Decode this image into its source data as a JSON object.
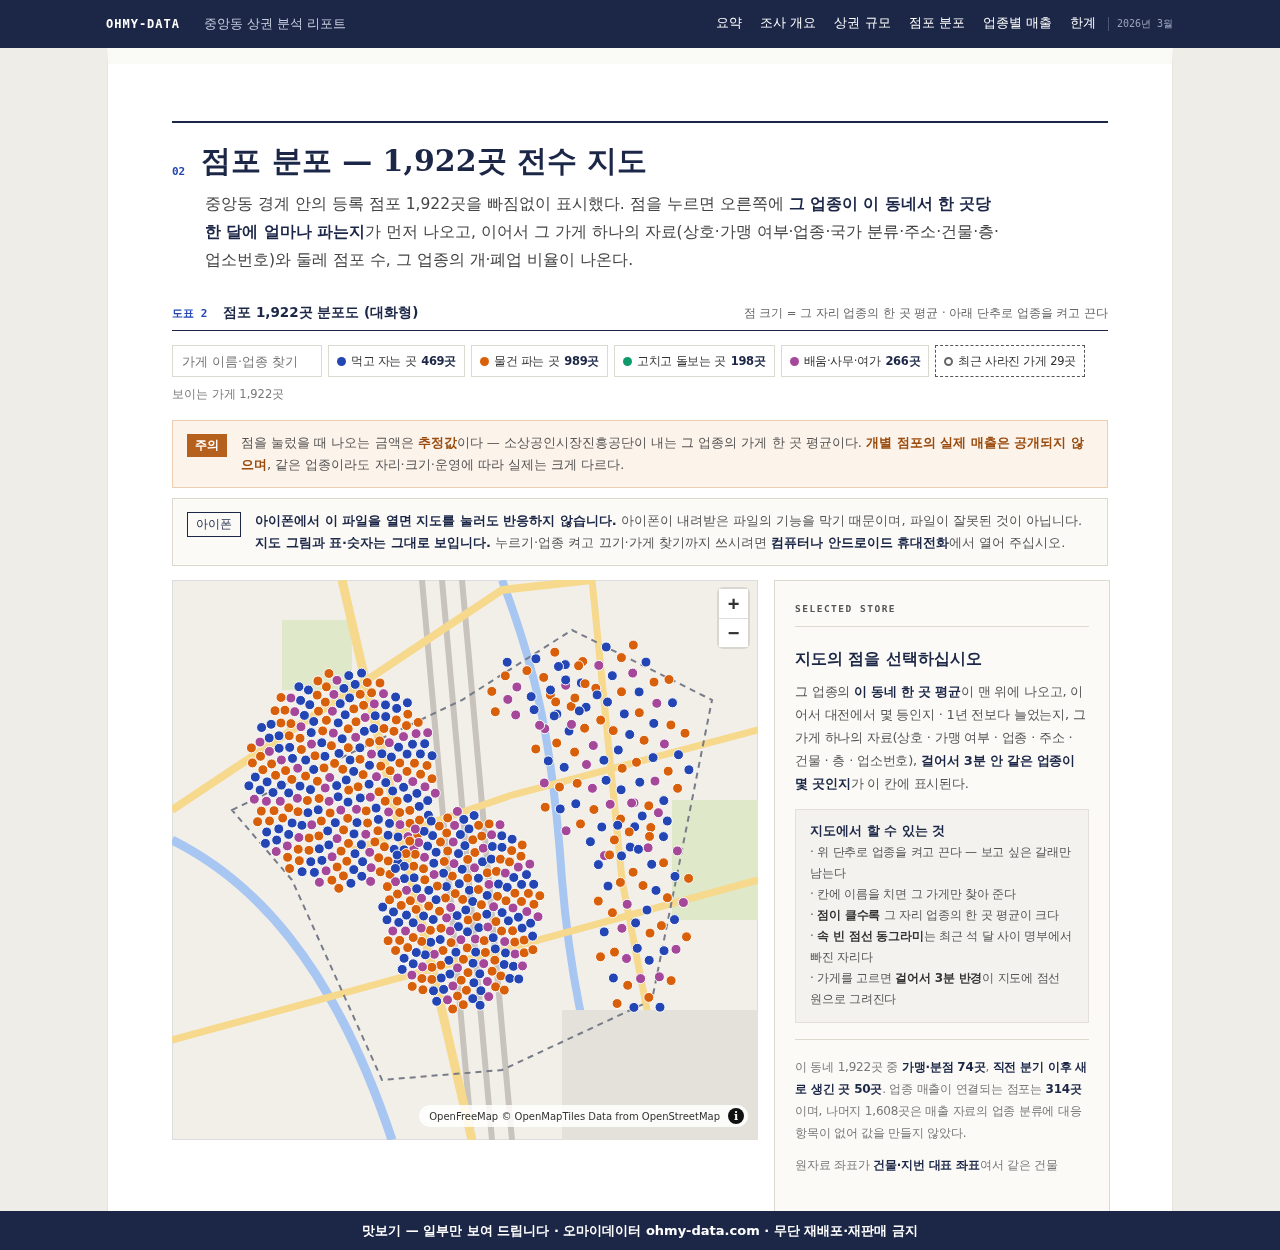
{
  "header": {
    "brand": "OHMY-DATA",
    "subtitle": "중앙동 상권 분석 리포트",
    "nav": [
      {
        "label": "요약",
        "selected": false
      },
      {
        "label": "조사 개요",
        "selected": false
      },
      {
        "label": "상권 규모",
        "selected": false
      },
      {
        "label": "점포 분포",
        "selected": false
      },
      {
        "label": "업종별 매출",
        "selected": false
      },
      {
        "label": "한계",
        "selected": false
      }
    ],
    "date": "2026년 3월"
  },
  "section": {
    "number": "02",
    "title": "점포 분포 — 1,922곳 전수 지도",
    "description": "중앙동 경계 안의 등록 점포 1,922곳을 빠짐없이 표시했다. 점을 누르면 오른쪽에 **그 업종이 이 동네서 한 곳당 한 달에 얼마나 파는지**가 먼저 나오고, 이어서 그 가게 하나의 자료(상호·가맹 여부·업종·국가 분류·주소·건물·층·업소번호)와 둘레 점포 수, 그 업종의 개·폐업 비율이 나온다."
  },
  "figure": {
    "label": "도표",
    "number": "2",
    "title": "점포 1,922곳 분포도 (대화형)",
    "note": "점 크기 = 그 자리 업종의 한 곳 평균 · 아래 단추로 업종을 켜고 끈다"
  },
  "search": {
    "placeholder": "가게 이름·업종 찾기"
  },
  "legend": [
    {
      "kind": "category",
      "label": "먹고 자는 곳",
      "count": "469곳",
      "color": "#2446b4"
    },
    {
      "kind": "category",
      "label": "물건 파는 곳",
      "count": "989곳",
      "color": "#d9600b"
    },
    {
      "kind": "category",
      "label": "고치고 돌보는 곳",
      "count": "198곳",
      "color": "#0f9a6e"
    },
    {
      "kind": "category",
      "label": "배움·사무·여가",
      "count": "266곳",
      "color": "#a6489a"
    },
    {
      "kind": "closed",
      "label": "최근 사라진 가게 29곳"
    }
  ],
  "visible_count": "보이는 가게 1,922곳",
  "notices": [
    {
      "kind": "warning",
      "tag": "주의",
      "text": "점을 눌렀을 때 나오는 금액은 **추정값**이다 — 소상공인시장진흥공단이 내는 그 업종의 가게 한 곳 평균이다. **개별 점포의 실제 매출은 공개되지 않으며**, 같은 업종이라도 자리·크기·운영에 따라 실제는 크게 다르다."
    },
    {
      "kind": "info",
      "tag": "아이폰",
      "text": "**아이폰에서 이 파일을 열면 지도를 눌러도 반응하지 않습니다.** 아이폰이 내려받은 파일의 기능을 막기 때문이며, 파일이 잘못된 것이 아닙니다. **지도 그림과 표·숫자는 그대로 보입니다.** 누르기·업종 켜고 끄기·가게 찾기까지 쓰시려면 **컴퓨터나 안드로이드 휴대전화**에서 열어 주십시오."
    }
  ],
  "map": {
    "zoom_in": "+",
    "zoom_out": "−",
    "attribution": "OpenFreeMap © OpenMapTiles Data from OpenStreetMap",
    "info": "i"
  },
  "panel": {
    "eyebrow": "SELECTED STORE",
    "title": "지도의 점을 선택하십시오",
    "intro": "그 업종의 **이 동네 한 곳 평균**이 맨 위에 나오고, 이어서 대전에서 몇 등인지 · 1년 전보다 늘었는지, 그 가게 하나의 자료(상호 · 가맹 여부 · 업종 · 주소 · 건물 · 층 · 업소번호), **걸어서 3분 안 같은 업종이 몇 곳인지**가 이 칸에 표시된다.",
    "tips_title": "지도에서 할 수 있는 것",
    "tips": [
      "· 위 단추로 업종을 켜고 끈다 — 보고 싶은 갈래만 남는다",
      "· 칸에 이름을 치면 그 가게만 찾아 준다",
      "· **점이 클수록** 그 자리 업종의 한 곳 평균이 크다",
      "· **속 빈 점선 동그라미**는 최근 석 달 사이 명부에서 빠진 자리다",
      "· 가게를 고르면 **걸어서 3분 반경**이 지도에 점선 원으로 그려진다"
    ],
    "notes": [
      "이 동네 1,922곳 중 **가맹·분점 74곳**, **직전 분기 이후 새로 생긴 곳 50곳**. 업종 매출이 연결되는 점포는 **314곳**이며, 나머지 1,608곳은 매출 자료의 업종 분류에 대응 항목이 없어 값을 만들지 않았다.",
      "원자료 좌표가 **건물·지번 대표 좌표**여서 같은 건물"
    ]
  },
  "footer": "맛보기 — 일부만 보여 드립니다 · 오마이데이터 ohmy-data.com · 무단 재배포·재판매 금지"
}
